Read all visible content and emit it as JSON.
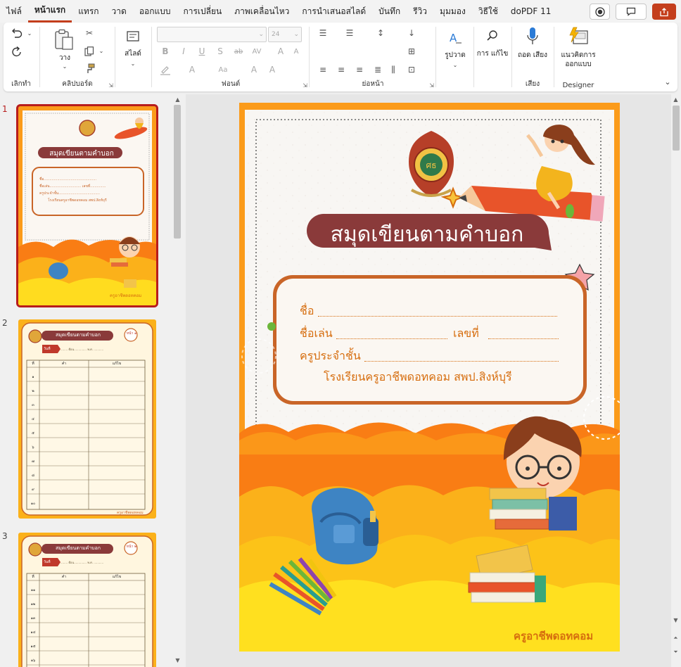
{
  "menu": {
    "items": [
      "ไฟล์",
      "หน้าแรก",
      "แทรก",
      "วาด",
      "ออกแบบ",
      "การเปลี่ยน",
      "ภาพเคลื่อนไหว",
      "การนำเสนอสไลด์",
      "บันทึก",
      "รีวิว",
      "มุมมอง",
      "วิธีใช้",
      "doPDF 11"
    ],
    "active": "หน้าแรก"
  },
  "ribbon": {
    "groups": {
      "undo": "เลิกทำ",
      "clipboard": "คลิปบอร์ด",
      "font": "ฟอนต์",
      "paragraph": "ย่อหน้า",
      "voice": "เสียง",
      "designer": "Designer"
    },
    "buttons": {
      "paste": "วาง",
      "slides": "สไลด์",
      "shapes": "รูปวาด",
      "editing": "การ แก้ไข",
      "dictate": "ถอด เสียง",
      "designer": "แนวคิดการ ออกแบบ"
    },
    "font_size": "24"
  },
  "thumbnails": {
    "numbers": [
      "1",
      "2",
      "3"
    ],
    "cover_title": "สมุดเขียนตามคำบอก",
    "cover_footer": "ครูอาชีพดอทคอม",
    "cover_fields": [
      "ชื่อ...............................................",
      "ชื่อเล่น............................ เลขที่..............",
      "ครูประจำชั้น.....................................",
      "โรงเรียนครูอาชีพดอทคอม สพป.สิงห์บุรี"
    ],
    "page_title": "สมุดเขียนตามคำบอก",
    "page_date_label": "วันที่",
    "page_date_line": "........ ดือน.............. พ.ศ. ...........",
    "table_headers": [
      "ที่",
      "คำ",
      "แก้ไข"
    ],
    "page2_badge": "หน้า ๑",
    "page3_badge": "หน้า ๒",
    "page2_rows": [
      "๑",
      "๒",
      "๓",
      "๔",
      "๕",
      "๖",
      "๗",
      "๘",
      "๙",
      "๑๐"
    ],
    "page3_rows": [
      "๑๑",
      "๑๒",
      "๑๓",
      "๑๔",
      "๑๕",
      "๑๖"
    ],
    "page_footer": "ครูอาชีพดอทคอม"
  },
  "slide": {
    "title": "สมุดเขียนตามคำบอก",
    "field_name": "ชื่อ",
    "field_nickname": "ชื่อเล่น",
    "field_number": "เลขที่",
    "field_teacher": "ครูประจำชั้น",
    "school_line": "โรงเรียนครูอาชีพดอทคอม สพป.สิงห์บุรี",
    "footer": "ครูอาชีพดอทคอม"
  },
  "colors": {
    "accent": "#c43e1c",
    "orange": "#fb9b1a",
    "title_bg": "#8a3a3a",
    "field_text": "#d66d0e",
    "yellow": "#ffd21a"
  }
}
